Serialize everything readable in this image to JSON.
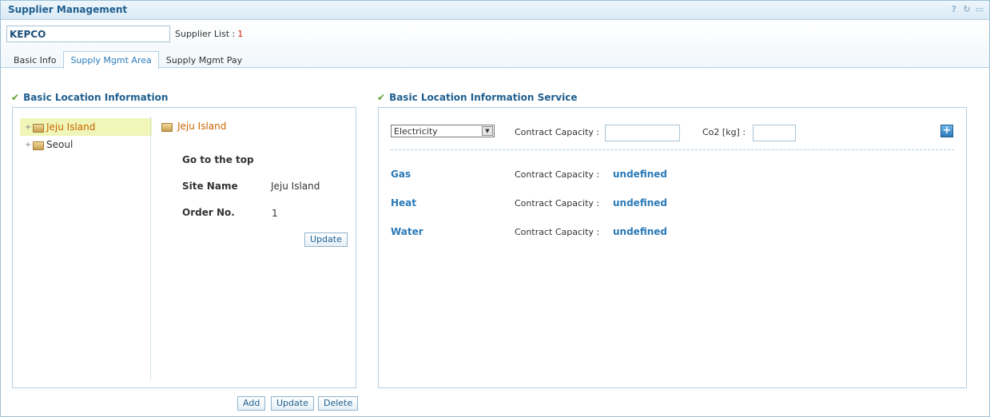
{
  "window": {
    "title": "Supplier Management",
    "icons": [
      "help-icon",
      "refresh-icon",
      "minimize-icon"
    ]
  },
  "supplier": {
    "name": "KEPCO",
    "list_label": "Supplier List :",
    "list_count": "1"
  },
  "tabs": [
    {
      "label": "Basic Info"
    },
    {
      "label": "Supply Mgmt Area"
    },
    {
      "label": "Supply Mgmt Pay"
    }
  ],
  "location_info": {
    "heading": "Basic Location Information",
    "tree": [
      {
        "label": "Jeju Island"
      },
      {
        "label": "Seoul"
      }
    ],
    "detail": {
      "title": "Jeju Island",
      "go_top": "Go to the top",
      "site_name_label": "Site Name",
      "site_name_value": "Jeju Island",
      "order_label": "Order No.",
      "order_value": "1",
      "update_label": "Update"
    },
    "buttons": {
      "add": "Add",
      "update": "Update",
      "delete": "Delete"
    }
  },
  "service": {
    "heading": "Basic Location Information Service",
    "selected_type": "Electricity",
    "capacity_label": "Contract Capacity :",
    "co2_label": "Co2 [kg] :",
    "rows": [
      {
        "name": "Gas",
        "label": "Contract Capacity :",
        "value": "undefined"
      },
      {
        "name": "Heat",
        "label": "Contract Capacity :",
        "value": "undefined"
      },
      {
        "name": "Water",
        "label": "Contract Capacity :",
        "value": "undefined"
      }
    ]
  }
}
